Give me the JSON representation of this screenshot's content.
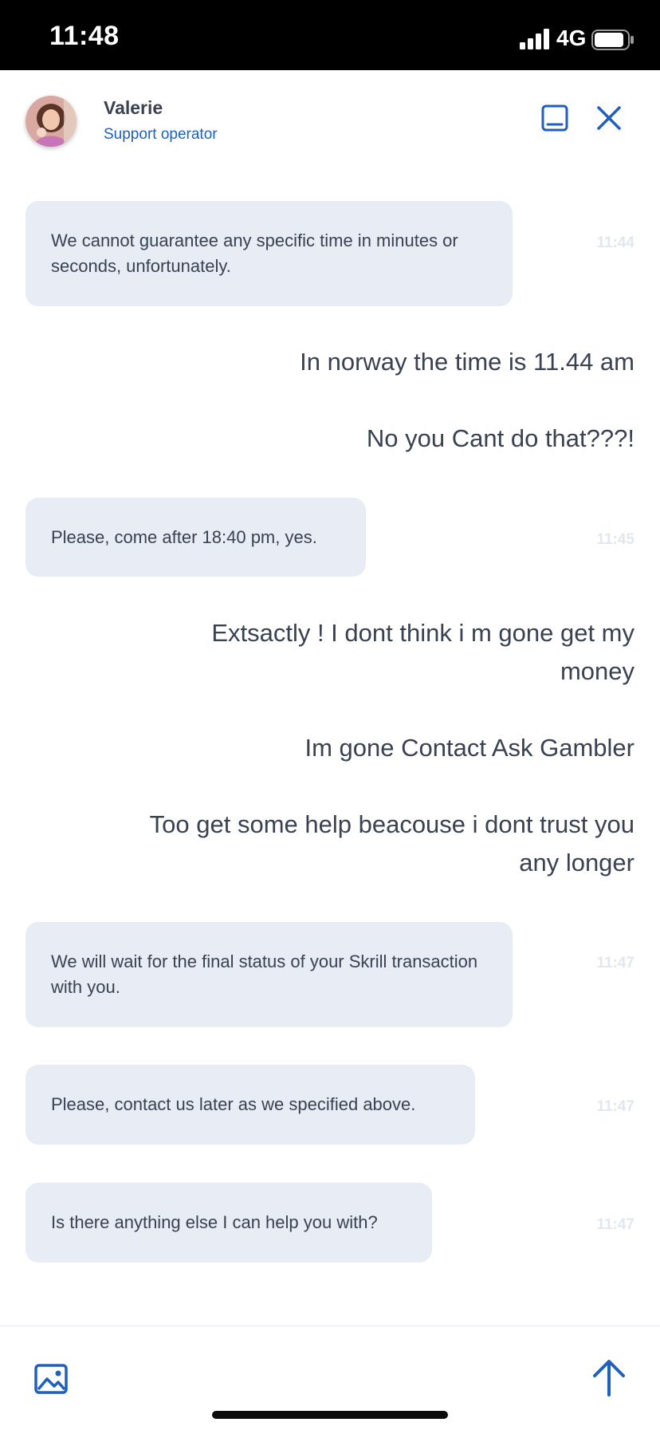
{
  "status_bar": {
    "time": "11:48",
    "network": "4G",
    "icons": [
      "signal-icon",
      "battery-icon"
    ]
  },
  "header": {
    "agent_name": "Valerie",
    "agent_role": "Support operator",
    "icons": [
      "minimize-icon",
      "close-icon"
    ],
    "accent_color": "#1f5fbf"
  },
  "messages": {
    "m1": {
      "text": "We cannot guarantee any specific time in minutes or seconds, unfortunately.",
      "time": "11:44"
    },
    "u1": {
      "text": "In norway the time is 11.44 am"
    },
    "u2": {
      "text": "No you Cant do that???!"
    },
    "m2": {
      "text": "Please, come after 18:40 pm, yes.",
      "time": "11:45"
    },
    "u3": {
      "text": "Extsactly ! I dont think i m gone get my money"
    },
    "u4": {
      "text": "Im gone Contact Ask Gambler"
    },
    "u5": {
      "text": "Too get some help beacouse i dont trust you any longer"
    },
    "m3": {
      "text": "We will wait for the final status of your Skrill transaction with you.",
      "time": "11:47"
    },
    "m4": {
      "text": "Please, contact us later as we specified above.",
      "time": "11:47"
    },
    "m5": {
      "text": "Is there anything else I can help you with?",
      "time": "11:47"
    }
  },
  "composer": {
    "icons": [
      "image-attach-icon",
      "send-arrow-icon"
    ]
  },
  "colors": {
    "operator_bubble": "#e7ecf5",
    "text": "#3a4150",
    "timestamp": "#e2e7ef"
  }
}
